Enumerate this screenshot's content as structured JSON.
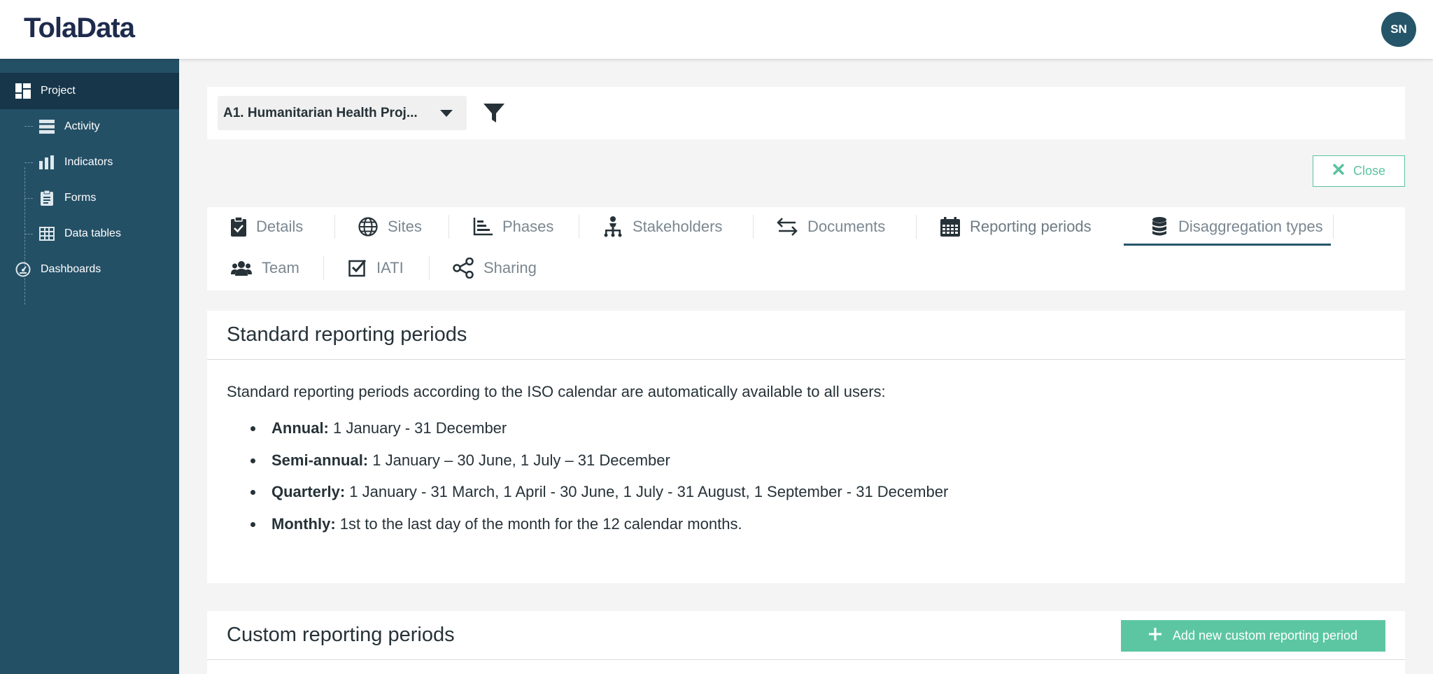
{
  "header": {
    "logo": "TolaData",
    "avatar_initials": "SN"
  },
  "sidebar": {
    "items": [
      {
        "label": "Project",
        "icon": "dashboard-grid-icon",
        "active": true
      },
      {
        "label": "Activity",
        "icon": "server-stack-icon"
      },
      {
        "label": "Indicators",
        "icon": "bar-chart-icon"
      },
      {
        "label": "Forms",
        "icon": "clipboard-icon"
      },
      {
        "label": "Data tables",
        "icon": "table-icon"
      },
      {
        "label": "Dashboards",
        "icon": "gauge-icon"
      }
    ]
  },
  "filter": {
    "program_selected": "A1. Humanitarian Health Proj...",
    "filter_icon": "funnel-icon"
  },
  "close_label": "Close",
  "tabs": [
    {
      "label": "Details",
      "icon": "clipboard-check-icon"
    },
    {
      "label": "Sites",
      "icon": "globe-icon"
    },
    {
      "label": "Phases",
      "icon": "chart-bars-icon"
    },
    {
      "label": "Stakeholders",
      "icon": "sitemap-icon"
    },
    {
      "label": "Documents",
      "icon": "exchange-arrows-icon"
    },
    {
      "label": "Reporting periods",
      "icon": "calendar-icon",
      "active": true
    },
    {
      "label": "Disaggregation types",
      "icon": "database-icon"
    },
    {
      "label": "Team",
      "icon": "users-icon"
    },
    {
      "label": "IATI",
      "icon": "checkbox-icon"
    },
    {
      "label": "Sharing",
      "icon": "share-nodes-icon"
    }
  ],
  "standard": {
    "title": "Standard reporting periods",
    "intro": "Standard reporting periods according to the ISO calendar are automatically available to all users:",
    "items": [
      {
        "term": "Annual:",
        "text": "1 January - 31 December"
      },
      {
        "term": "Semi-annual:",
        "text": "1 January – 30 June, 1 July – 31 December"
      },
      {
        "term": "Quarterly:",
        "text": "1 January - 31 March, 1 April - 30 June, 1 July - 31 August, 1 September - 31 December"
      },
      {
        "term": "Monthly:",
        "text": "1st to the last day of the month for the 12 calendar months."
      }
    ]
  },
  "custom": {
    "title": "Custom reporting periods",
    "add_label": "Add new custom reporting period"
  },
  "colors": {
    "sidebar": "#245066",
    "sidebar_active": "#17364a",
    "accent": "#5cc6a3",
    "primary": "#245569"
  }
}
